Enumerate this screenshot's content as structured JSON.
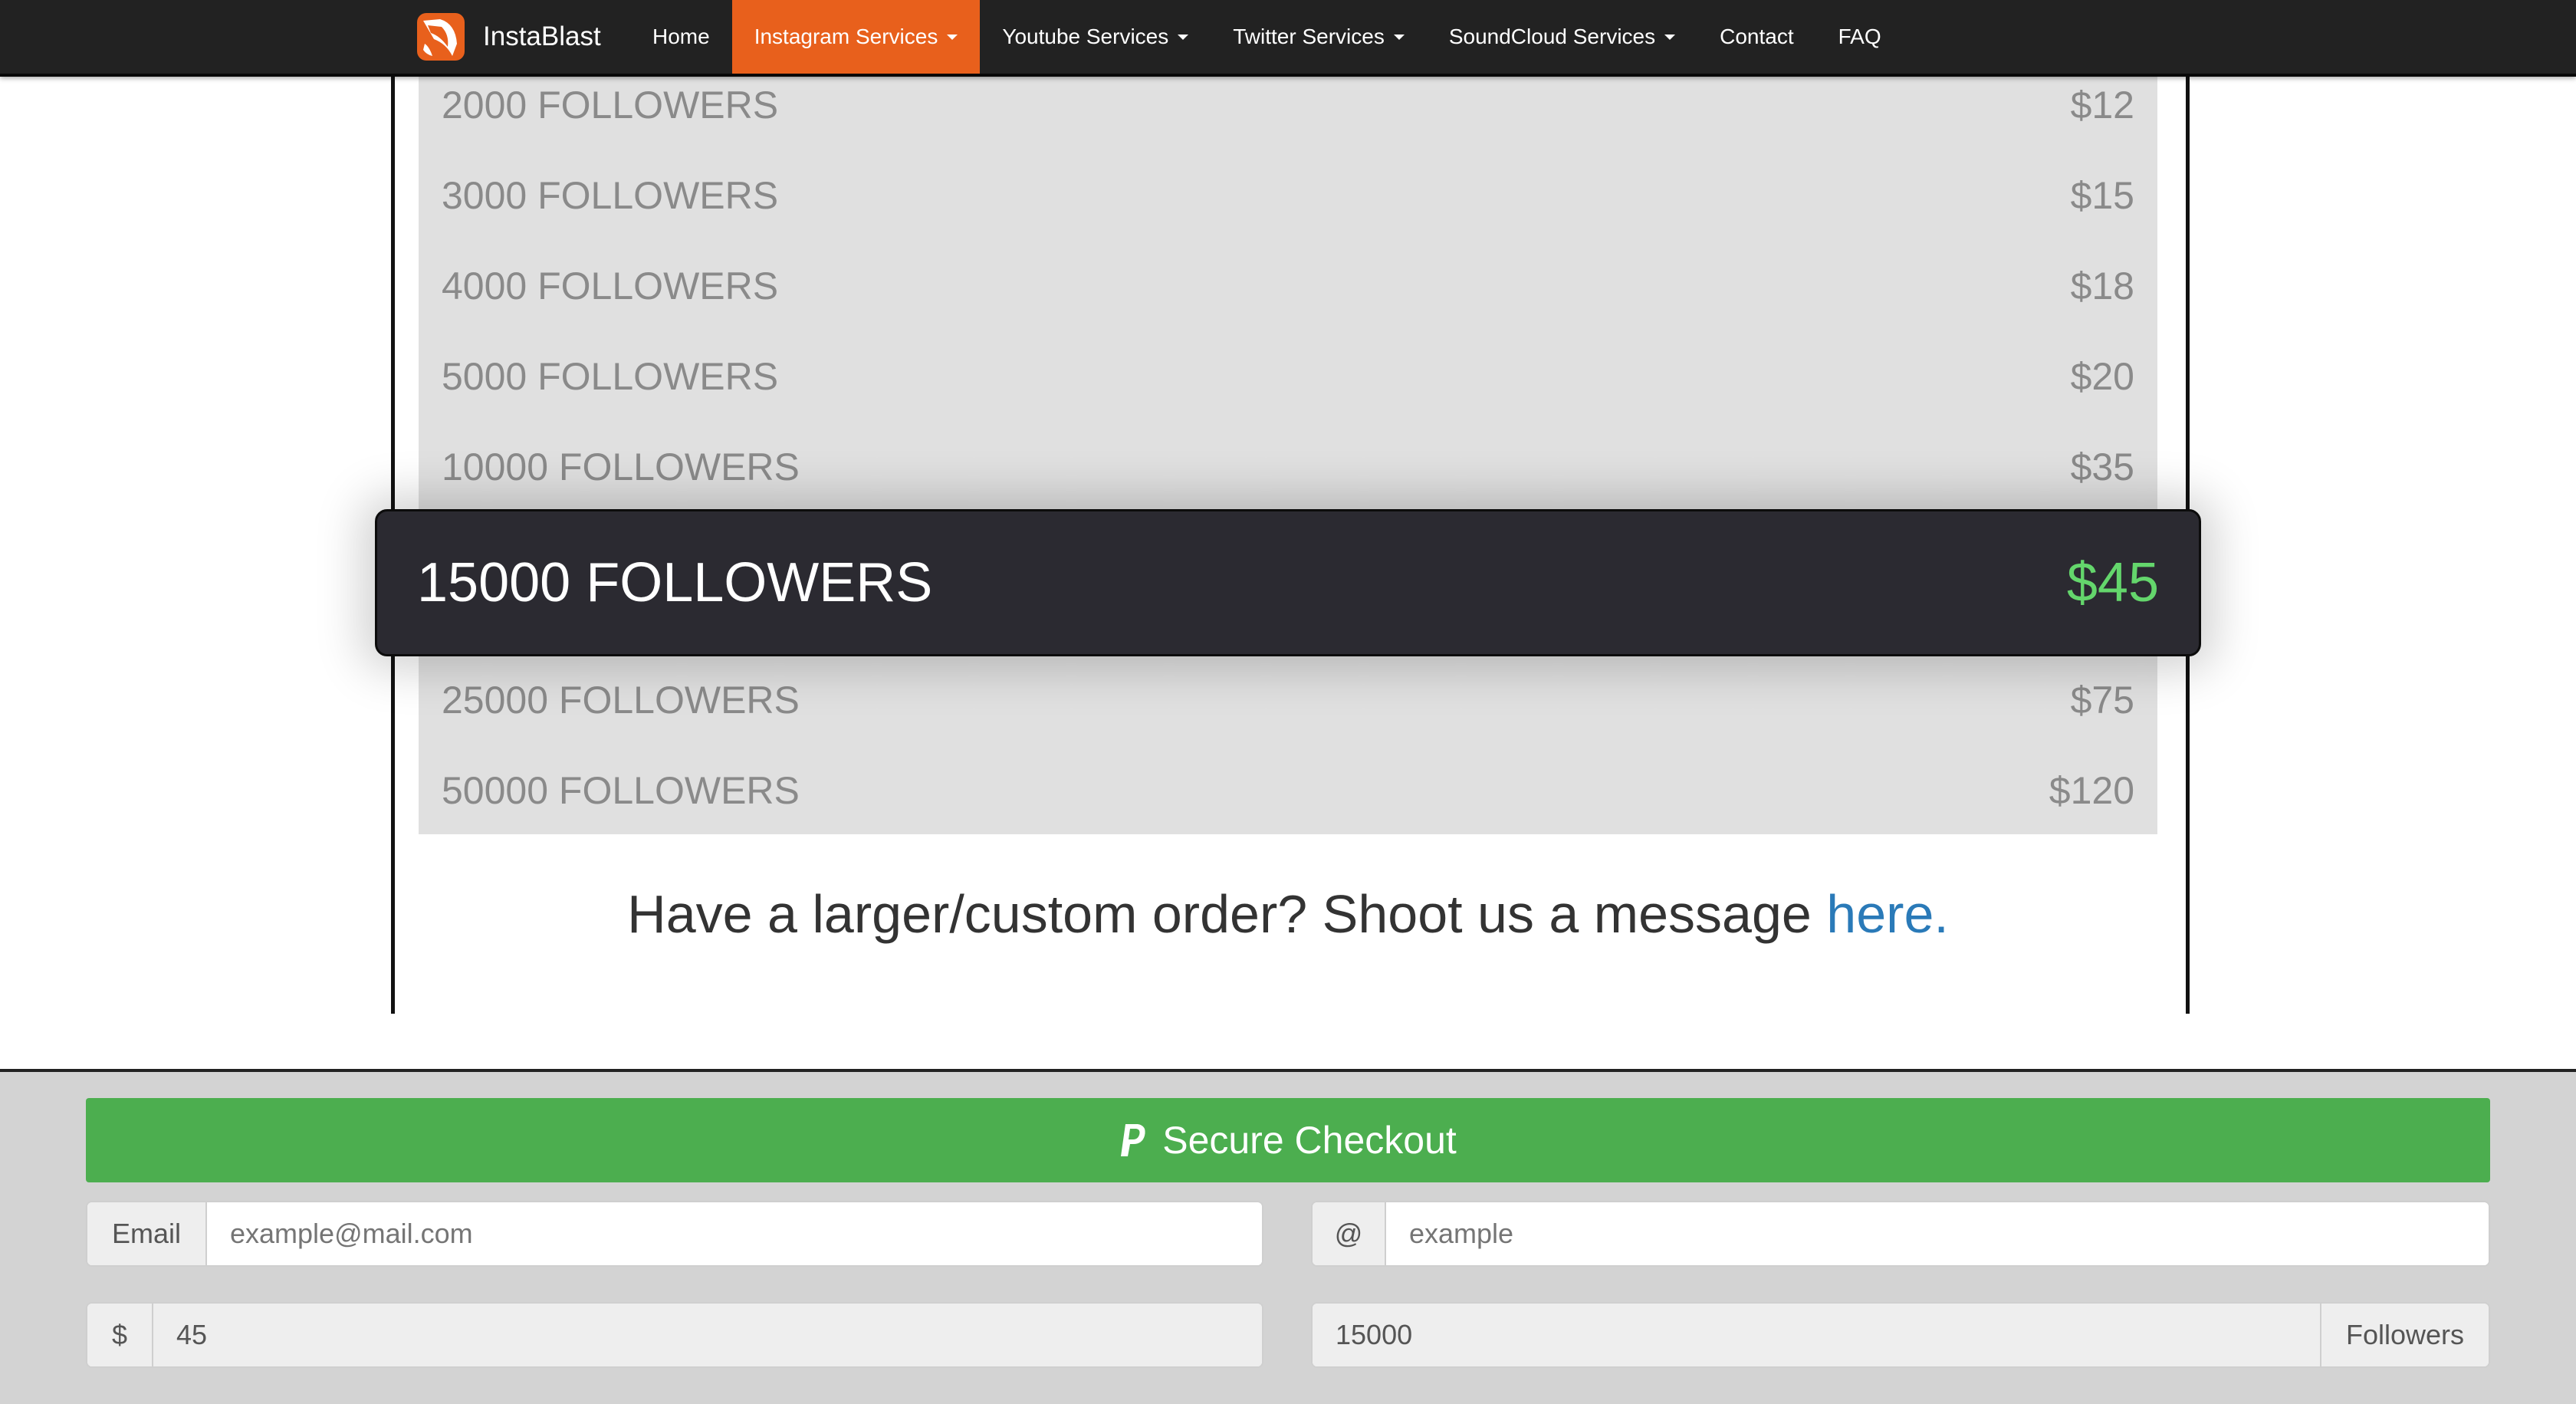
{
  "brand": {
    "name": "InstaBlast",
    "accent": "#e8601c"
  },
  "nav": {
    "items": [
      {
        "label": "Home"
      },
      {
        "label": "Instagram Services",
        "dropdown": true,
        "active": true
      },
      {
        "label": "Youtube Services",
        "dropdown": true
      },
      {
        "label": "Twitter Services",
        "dropdown": true
      },
      {
        "label": "SoundCloud Services",
        "dropdown": true
      },
      {
        "label": "Contact"
      },
      {
        "label": "FAQ"
      }
    ]
  },
  "pricing": {
    "tiers": [
      {
        "qty": "2000 FOLLOWERS",
        "price": "$12"
      },
      {
        "qty": "3000 FOLLOWERS",
        "price": "$15"
      },
      {
        "qty": "4000 FOLLOWERS",
        "price": "$18"
      },
      {
        "qty": "5000 FOLLOWERS",
        "price": "$20"
      },
      {
        "qty": "10000 FOLLOWERS",
        "price": "$35"
      },
      {
        "qty": "15000 FOLLOWERS",
        "price": "$45",
        "selected": true
      },
      {
        "qty": "25000 FOLLOWERS",
        "price": "$75"
      },
      {
        "qty": "50000 FOLLOWERS",
        "price": "$120"
      }
    ],
    "highlight_price_color": "#64d66c",
    "custom_text": "Have a larger/custom order? Shoot us a message ",
    "custom_link": "here."
  },
  "checkout": {
    "button_label": "Secure Checkout",
    "button_icon": "paypal-icon",
    "button_color": "#4cae4f",
    "email": {
      "addon": "Email",
      "placeholder": "example@mail.com",
      "value": ""
    },
    "username": {
      "addon": "@",
      "placeholder": "example",
      "value": ""
    },
    "price": {
      "addon": "$",
      "value": "45"
    },
    "followers": {
      "value": "15000",
      "addon": "Followers"
    }
  }
}
